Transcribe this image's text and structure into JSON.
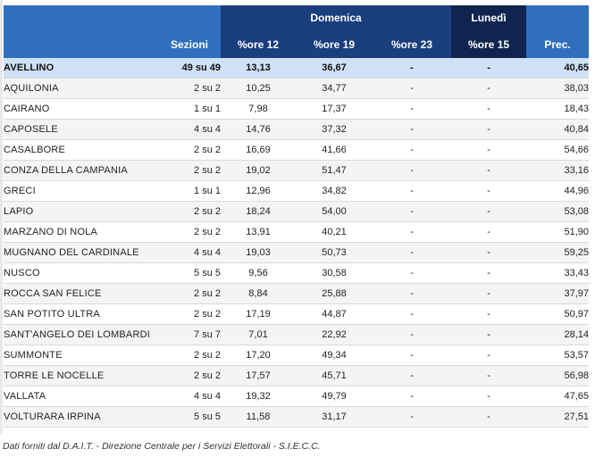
{
  "header": {
    "group_domenica": "Domenica",
    "group_lunedi": "Lunedì",
    "col_sezioni": "Sezioni",
    "col_ore12": "%ore 12",
    "col_ore19": "%ore 19",
    "col_ore23": "%ore 23",
    "col_ore15": "%ore 15",
    "col_prec": "Prec."
  },
  "total": {
    "comune": "AVELLINO",
    "sezioni": "49 su 49",
    "ore12": "13,13",
    "ore19": "36,67",
    "ore23": "-",
    "ore15": "-",
    "prec": "40,65"
  },
  "rows": [
    {
      "comune": "AQUILONIA",
      "sezioni": "2 su 2",
      "ore12": "10,25",
      "ore19": "34,77",
      "ore23": "-",
      "ore15": "-",
      "prec": "38,03"
    },
    {
      "comune": "CAIRANO",
      "sezioni": "1 su 1",
      "ore12": "7,98",
      "ore19": "17,37",
      "ore23": "-",
      "ore15": "-",
      "prec": "18,43"
    },
    {
      "comune": "CAPOSELE",
      "sezioni": "4 su 4",
      "ore12": "14,76",
      "ore19": "37,32",
      "ore23": "-",
      "ore15": "-",
      "prec": "40,84"
    },
    {
      "comune": "CASALBORE",
      "sezioni": "2 su 2",
      "ore12": "16,69",
      "ore19": "41,66",
      "ore23": "-",
      "ore15": "-",
      "prec": "54,66"
    },
    {
      "comune": "CONZA DELLA CAMPANIA",
      "sezioni": "2 su 2",
      "ore12": "19,02",
      "ore19": "51,47",
      "ore23": "-",
      "ore15": "-",
      "prec": "33,16"
    },
    {
      "comune": "GRECI",
      "sezioni": "1 su 1",
      "ore12": "12,96",
      "ore19": "34,82",
      "ore23": "-",
      "ore15": "-",
      "prec": "44,96"
    },
    {
      "comune": "LAPIO",
      "sezioni": "2 su 2",
      "ore12": "18,24",
      "ore19": "54,00",
      "ore23": "-",
      "ore15": "-",
      "prec": "53,08"
    },
    {
      "comune": "MARZANO DI NOLA",
      "sezioni": "2 su 2",
      "ore12": "13,91",
      "ore19": "40,21",
      "ore23": "-",
      "ore15": "-",
      "prec": "51,90"
    },
    {
      "comune": "MUGNANO DEL CARDINALE",
      "sezioni": "4 su 4",
      "ore12": "19,03",
      "ore19": "50,73",
      "ore23": "-",
      "ore15": "-",
      "prec": "59,25"
    },
    {
      "comune": "NUSCO",
      "sezioni": "5 su 5",
      "ore12": "9,56",
      "ore19": "30,58",
      "ore23": "-",
      "ore15": "-",
      "prec": "33,43"
    },
    {
      "comune": "ROCCA SAN FELICE",
      "sezioni": "2 su 2",
      "ore12": "8,84",
      "ore19": "25,88",
      "ore23": "-",
      "ore15": "-",
      "prec": "37,97"
    },
    {
      "comune": "SAN POTITO ULTRA",
      "sezioni": "2 su 2",
      "ore12": "17,19",
      "ore19": "44,87",
      "ore23": "-",
      "ore15": "-",
      "prec": "50,97"
    },
    {
      "comune": "SANT'ANGELO DEI LOMBARDI",
      "sezioni": "7 su 7",
      "ore12": "7,01",
      "ore19": "22,92",
      "ore23": "-",
      "ore15": "-",
      "prec": "28,14"
    },
    {
      "comune": "SUMMONTE",
      "sezioni": "2 su 2",
      "ore12": "17,20",
      "ore19": "49,34",
      "ore23": "-",
      "ore15": "-",
      "prec": "53,57"
    },
    {
      "comune": "TORRE LE NOCELLE",
      "sezioni": "2 su 2",
      "ore12": "17,57",
      "ore19": "45,71",
      "ore23": "-",
      "ore15": "-",
      "prec": "56,98"
    },
    {
      "comune": "VALLATA",
      "sezioni": "4 su 4",
      "ore12": "19,32",
      "ore19": "49,79",
      "ore23": "-",
      "ore15": "-",
      "prec": "47,65"
    },
    {
      "comune": "VOLTURARA IRPINA",
      "sezioni": "5 su 5",
      "ore12": "11,58",
      "ore19": "31,17",
      "ore23": "-",
      "ore15": "-",
      "prec": "27,51"
    }
  ],
  "footer": {
    "source": "Dati forniti dal D.A.I.T. - Direzione Centrale per i Servizi Elettorali - S.I.E.C.C."
  }
}
